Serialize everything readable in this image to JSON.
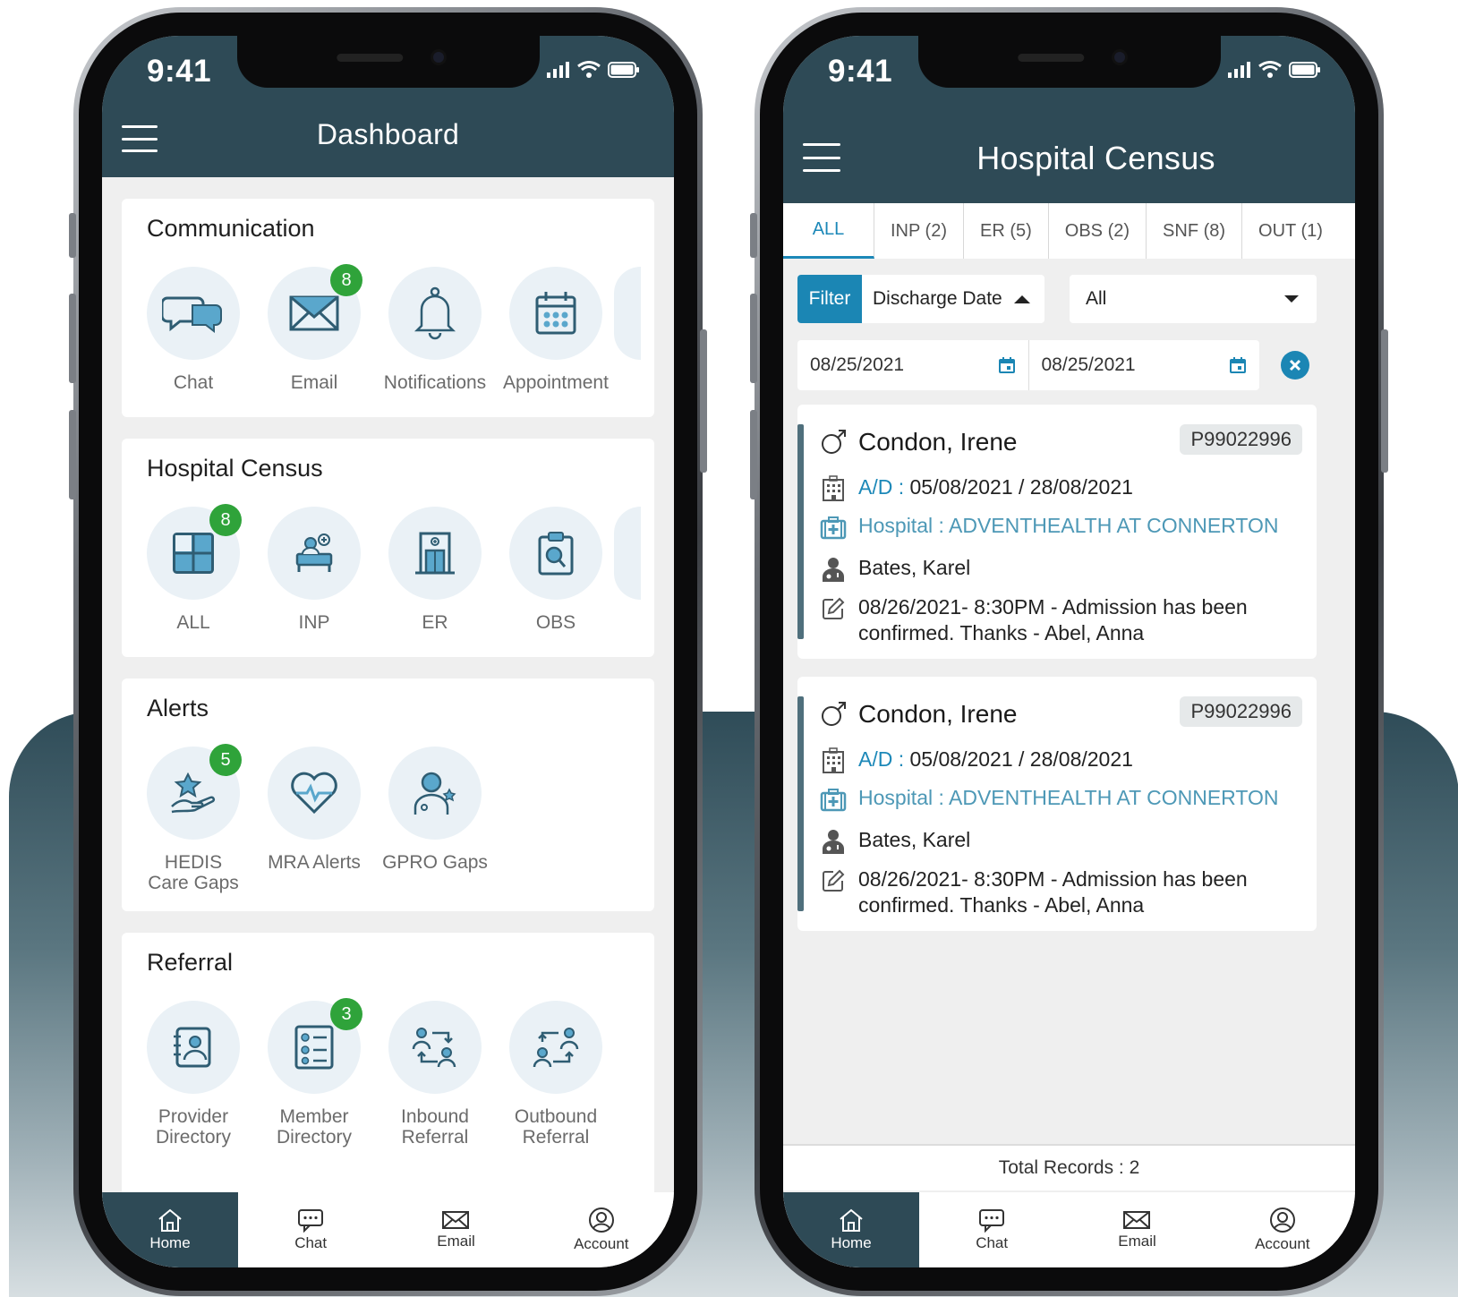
{
  "status_time": "9:41",
  "left": {
    "title": "Dashboard",
    "sections": [
      {
        "title": "Communication",
        "tiles": [
          {
            "label": "Chat",
            "icon": "chat-icon",
            "badge": ""
          },
          {
            "label": "Email",
            "icon": "email-icon",
            "badge": "8"
          },
          {
            "label": "Notifications",
            "icon": "bell-icon",
            "badge": ""
          },
          {
            "label": "Appointment",
            "icon": "calendar-icon",
            "badge": ""
          }
        ]
      },
      {
        "title": "Hospital Census",
        "tiles": [
          {
            "label": "ALL",
            "icon": "grid-icon",
            "badge": "8"
          },
          {
            "label": "INP",
            "icon": "inpatient-bed-icon",
            "badge": ""
          },
          {
            "label": "ER",
            "icon": "hospital-door-icon",
            "badge": ""
          },
          {
            "label": "OBS",
            "icon": "clipboard-search-icon",
            "badge": ""
          }
        ]
      },
      {
        "title": "Alerts",
        "tiles": [
          {
            "label": "HEDIS",
            "label2": "Care Gaps",
            "icon": "hand-star-icon",
            "badge": "5"
          },
          {
            "label": "MRA Alerts",
            "icon": "heart-pulse-icon",
            "badge": ""
          },
          {
            "label": "GPRO Gaps",
            "icon": "doctor-star-icon",
            "badge": ""
          }
        ]
      },
      {
        "title": "Referral",
        "tiles": [
          {
            "label": "Provider",
            "label2": "Directory",
            "icon": "provider-directory-icon",
            "badge": ""
          },
          {
            "label": "Member",
            "label2": "Directory",
            "icon": "member-directory-icon",
            "badge": "3"
          },
          {
            "label": "Inbound",
            "label2": "Referral",
            "icon": "inbound-referral-icon",
            "badge": ""
          },
          {
            "label": "Outbound",
            "label2": "Referral",
            "icon": "outbound-referral-icon",
            "badge": ""
          }
        ]
      }
    ],
    "nav": [
      "Home",
      "Chat",
      "Email",
      "Account"
    ]
  },
  "right": {
    "title": "Hospital Census",
    "tabs": [
      "ALL",
      "INP (2)",
      "ER (5)",
      "OBS (2)",
      "SNF (8)",
      "OUT (1)"
    ],
    "filter_label": "Filter",
    "filter_field": "Discharge Date",
    "select_value": "All",
    "date_from": "08/25/2021",
    "date_to": "08/25/2021",
    "records": [
      {
        "name": "Condon, Irene",
        "id": "P99022996",
        "ad_label": "A/D :",
        "ad_value": "05/08/2021 / 28/08/2021",
        "hospital": "Hospital : ADVENTHEALTH AT CONNERTON",
        "doctor": "Bates, Karel",
        "note_line1": "08/26/2021- 8:30PM - Admission has been",
        "note_line2": "confirmed. Thanks -  Abel, Anna"
      },
      {
        "name": "Condon, Irene",
        "id": "P99022996",
        "ad_label": "A/D :",
        "ad_value": "05/08/2021 / 28/08/2021",
        "hospital": "Hospital : ADVENTHEALTH AT CONNERTON",
        "doctor": "Bates, Karel",
        "note_line1": "08/26/2021- 8:30PM - Admission has been",
        "note_line2": "confirmed. Thanks -  Abel, Anna"
      }
    ],
    "total": "Total Records : 2",
    "nav": [
      "Home",
      "Chat",
      "Email",
      "Account"
    ]
  },
  "colors": {
    "header": "#2e4a56",
    "accent": "#1b86b4",
    "badge": "#2fa33a",
    "tile_bg": "#eaf1f6"
  }
}
